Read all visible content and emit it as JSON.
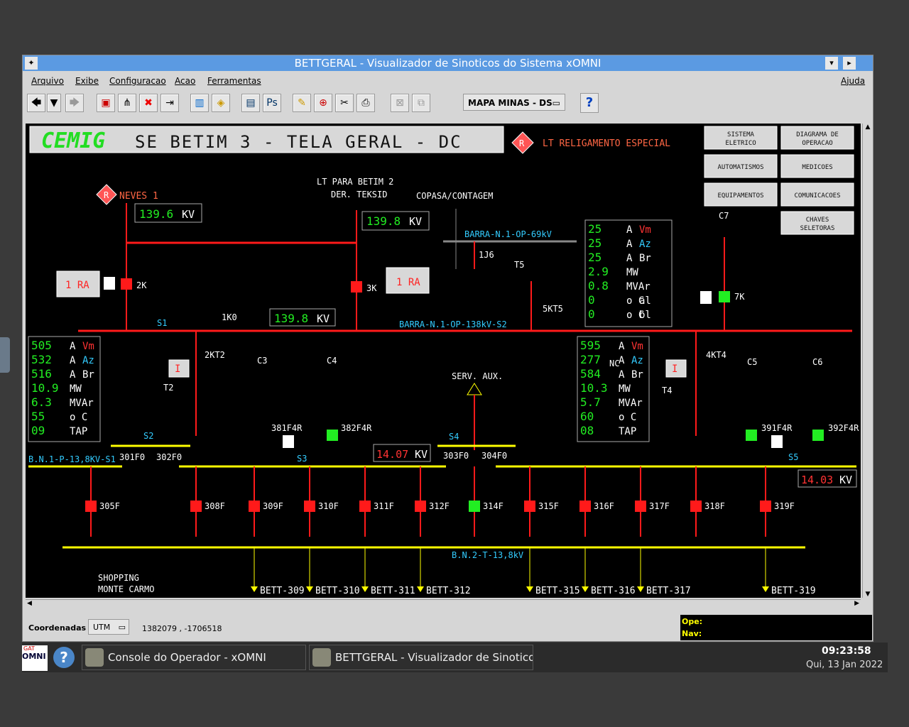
{
  "window": {
    "title": "BETTGERAL - Visualizador de Sinoticos do Sistema xOMNI"
  },
  "menu": {
    "arquivo": "Arquivo",
    "exibe": "Exibe",
    "configuracao": "Configuracao",
    "acao": "Acao",
    "ferramentas": "Ferramentas",
    "ajuda": "Ajuda"
  },
  "toolbar": {
    "map_select": "MAPA MINAS - DS",
    "help": "?"
  },
  "diagram": {
    "logo": "CEMIG",
    "title": "SE BETIM 3 - TELA GERAL - DC",
    "lt_religamento": "LT RELIGAMENTO ESPECIAL",
    "r_badge": "R",
    "buttons": [
      "SISTEMA ELETRICO",
      "DIAGRAMA DE OPERACAO",
      "AUTOMATISMOS",
      "MEDICOES",
      "EQUIPAMENTOS",
      "COMUNICACOES",
      "CHAVES SELETORAS"
    ],
    "neves": "NEVES 1",
    "lt_betim_1": "LT PARA BETIM 2",
    "lt_betim_2": "DER. TEKSID",
    "copasa": "COPASA/CONTAGEM",
    "barra_69": "BARRA-N.1-OP-69kV",
    "barra_138": "BARRA-N.1-OP-138kV-S2",
    "bn_p": "B.N.1-P-13,8KV-S1",
    "bn_t": "B.N.2-T-13,8kV",
    "serv_aux": "SERV. AUX.",
    "kv_unit": "KV",
    "kv_values": {
      "neves": "139.6",
      "betim": "139.8",
      "bar1k0": "139.8",
      "s3": "14.07",
      "s5": "14.03"
    },
    "ra_label": "1 RA",
    "i_label": "I",
    "labels": {
      "2k": "2K",
      "3k": "3K",
      "1k0": "1K0",
      "1j6": "1J6",
      "t5": "T5",
      "5kt5": "5KT5",
      "7k": "7K",
      "c7": "C7",
      "s1": "S1",
      "s2": "S2",
      "s3": "S3",
      "s4": "S4",
      "s5": "S5",
      "2kt2": "2KT2",
      "4kt4": "4KT4",
      "t2": "T2",
      "t4": "T4",
      "c3": "C3",
      "c4": "C4",
      "c5": "C5",
      "c6": "C6",
      "381": "381F4R",
      "382": "382F4R",
      "391": "391F4R",
      "392": "392F4R",
      "301": "301F0",
      "302": "302F0",
      "303": "303F0",
      "304": "304F0"
    },
    "feeders": [
      "305F",
      "308F",
      "309F",
      "310F",
      "311F",
      "312F",
      "314F",
      "315F",
      "316F",
      "317F",
      "318F",
      "319F"
    ],
    "outputs": [
      "SHOPPING",
      "MONTE CARMO",
      "BETT-309",
      "BETT-310",
      "BETT-311",
      "BETT-312",
      "BETT-315",
      "BETT-316",
      "BETT-317",
      "BETT-319"
    ],
    "meas_t5": {
      "vals": [
        "25",
        "25",
        "25",
        "2.9",
        "0.8",
        "0",
        "0"
      ],
      "units": [
        "A",
        "A",
        "A",
        "MW",
        "MVAr",
        "o C",
        "o C"
      ],
      "tags": [
        "Vm",
        "Az",
        "Br",
        "",
        "",
        "al",
        "bl"
      ]
    },
    "meas_t2": {
      "vals": [
        "505",
        "532",
        "516",
        "10.9",
        "6.3",
        "55",
        "09"
      ],
      "units": [
        "A",
        "A",
        "A",
        "MW",
        "MVAr",
        "o C",
        "TAP"
      ],
      "tags": [
        "Vm",
        "Az",
        "Br",
        "",
        "",
        "",
        ""
      ]
    },
    "meas_t4": {
      "vals": [
        "595",
        "277",
        "584",
        "10.3",
        "5.7",
        "60",
        "08"
      ],
      "units": [
        "A",
        "A",
        "A",
        "MW",
        "MVAr",
        "o C",
        "TAP"
      ],
      "tags": [
        "Vm",
        "Az",
        "Br",
        "",
        "",
        "",
        ""
      ],
      "nc": "NC"
    }
  },
  "status": {
    "coord_label": "Coordenadas",
    "coord_system": "UTM",
    "coord_value": "1382079 , -1706518",
    "ope": "Ope:",
    "nav": "Nav:"
  },
  "taskbar": {
    "logo_top": "GAT",
    "logo_bottom": "OMNI",
    "task1": "Console do Operador - xOMNI",
    "task2": "BETTGERAL - Visualizador de Sinotico",
    "time": "09:23:58",
    "date": "Qui, 13 Jan 2022"
  },
  "colors": {
    "bus_red": "#ff1a1a",
    "bus_yellow": "#ffff00",
    "green": "#22ee22",
    "cyan": "#33ccff",
    "window_title": "#5b9ae2"
  }
}
